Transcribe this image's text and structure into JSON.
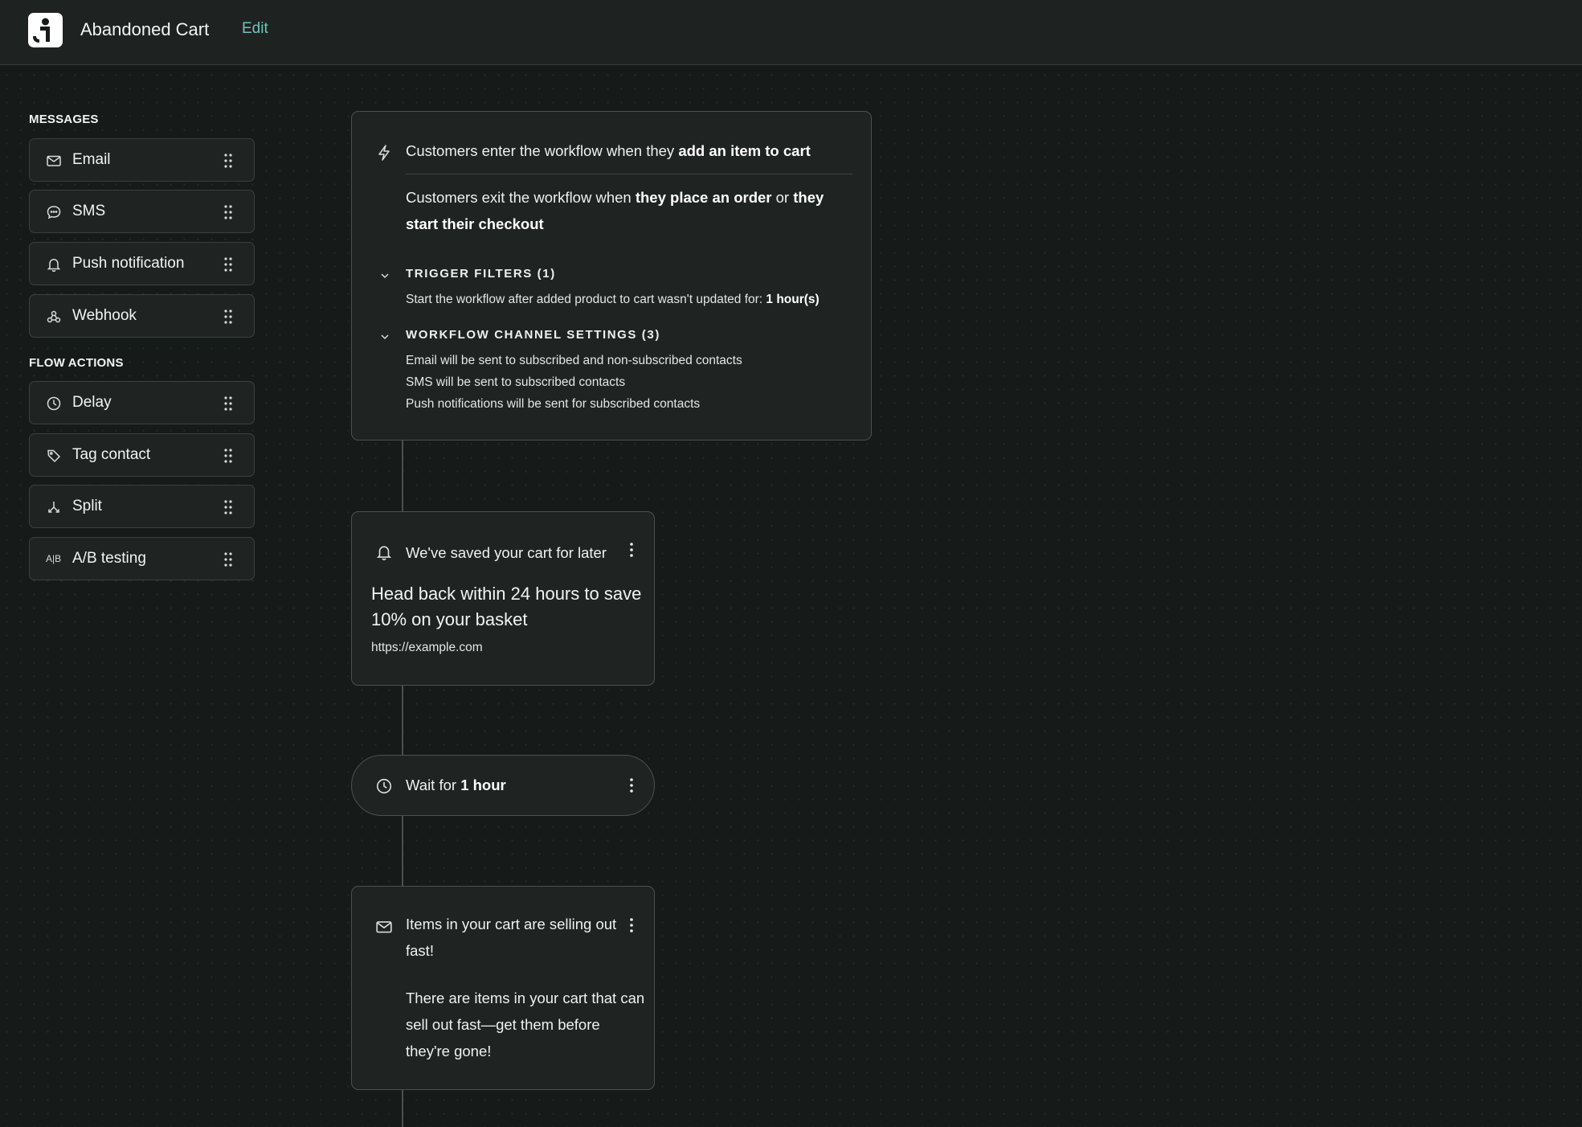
{
  "app": {
    "title": "Abandoned Cart",
    "edit_label": "Edit"
  },
  "palette": {
    "messages_heading": "MESSAGES",
    "flow_actions_heading": "FLOW ACTIONS",
    "messages": [
      {
        "label": "Email",
        "icon": "envelope-icon"
      },
      {
        "label": "SMS",
        "icon": "chat-bubble-icon"
      },
      {
        "label": "Push notification",
        "icon": "bell-icon"
      },
      {
        "label": "Webhook",
        "icon": "webhook-icon"
      }
    ],
    "flow_actions": [
      {
        "label": "Delay",
        "icon": "clock-icon"
      },
      {
        "label": "Tag contact",
        "icon": "tag-icon"
      },
      {
        "label": "Split",
        "icon": "split-icon"
      },
      {
        "label": "A/B testing",
        "icon": "ab-icon",
        "icon_text": "A|B"
      }
    ]
  },
  "trigger": {
    "enter_prefix": "Customers enter the workflow when they ",
    "enter_bold": "add an item to cart",
    "exit_prefix": "Customers exit the workflow when ",
    "exit_bold_1": "they place an order",
    "exit_or": " or ",
    "exit_bold_2": "they start their checkout",
    "filters_heading": "TRIGGER FILTERS (1)",
    "filters_text_prefix": "Start the workflow after added product to cart wasn't updated for: ",
    "filters_text_bold": "1 hour(s)",
    "channel_heading": "WORKFLOW CHANNEL SETTINGS (3)",
    "channel_lines": [
      "Email will be sent to subscribed and non-subscribed contacts",
      "SMS will be sent to subscribed contacts",
      "Push notifications will be sent for subscribed contacts"
    ]
  },
  "push_step": {
    "title": "We've saved your cart for later",
    "body": "Head back within 24 hours to save 10% on your basket",
    "url": "https://example.com"
  },
  "delay_step": {
    "prefix": "Wait for ",
    "bold": "1 hour"
  },
  "email_step": {
    "title": "Items in your cart are selling out fast!",
    "body": "There are items in your cart that can sell out fast—get them before they're gone!"
  }
}
